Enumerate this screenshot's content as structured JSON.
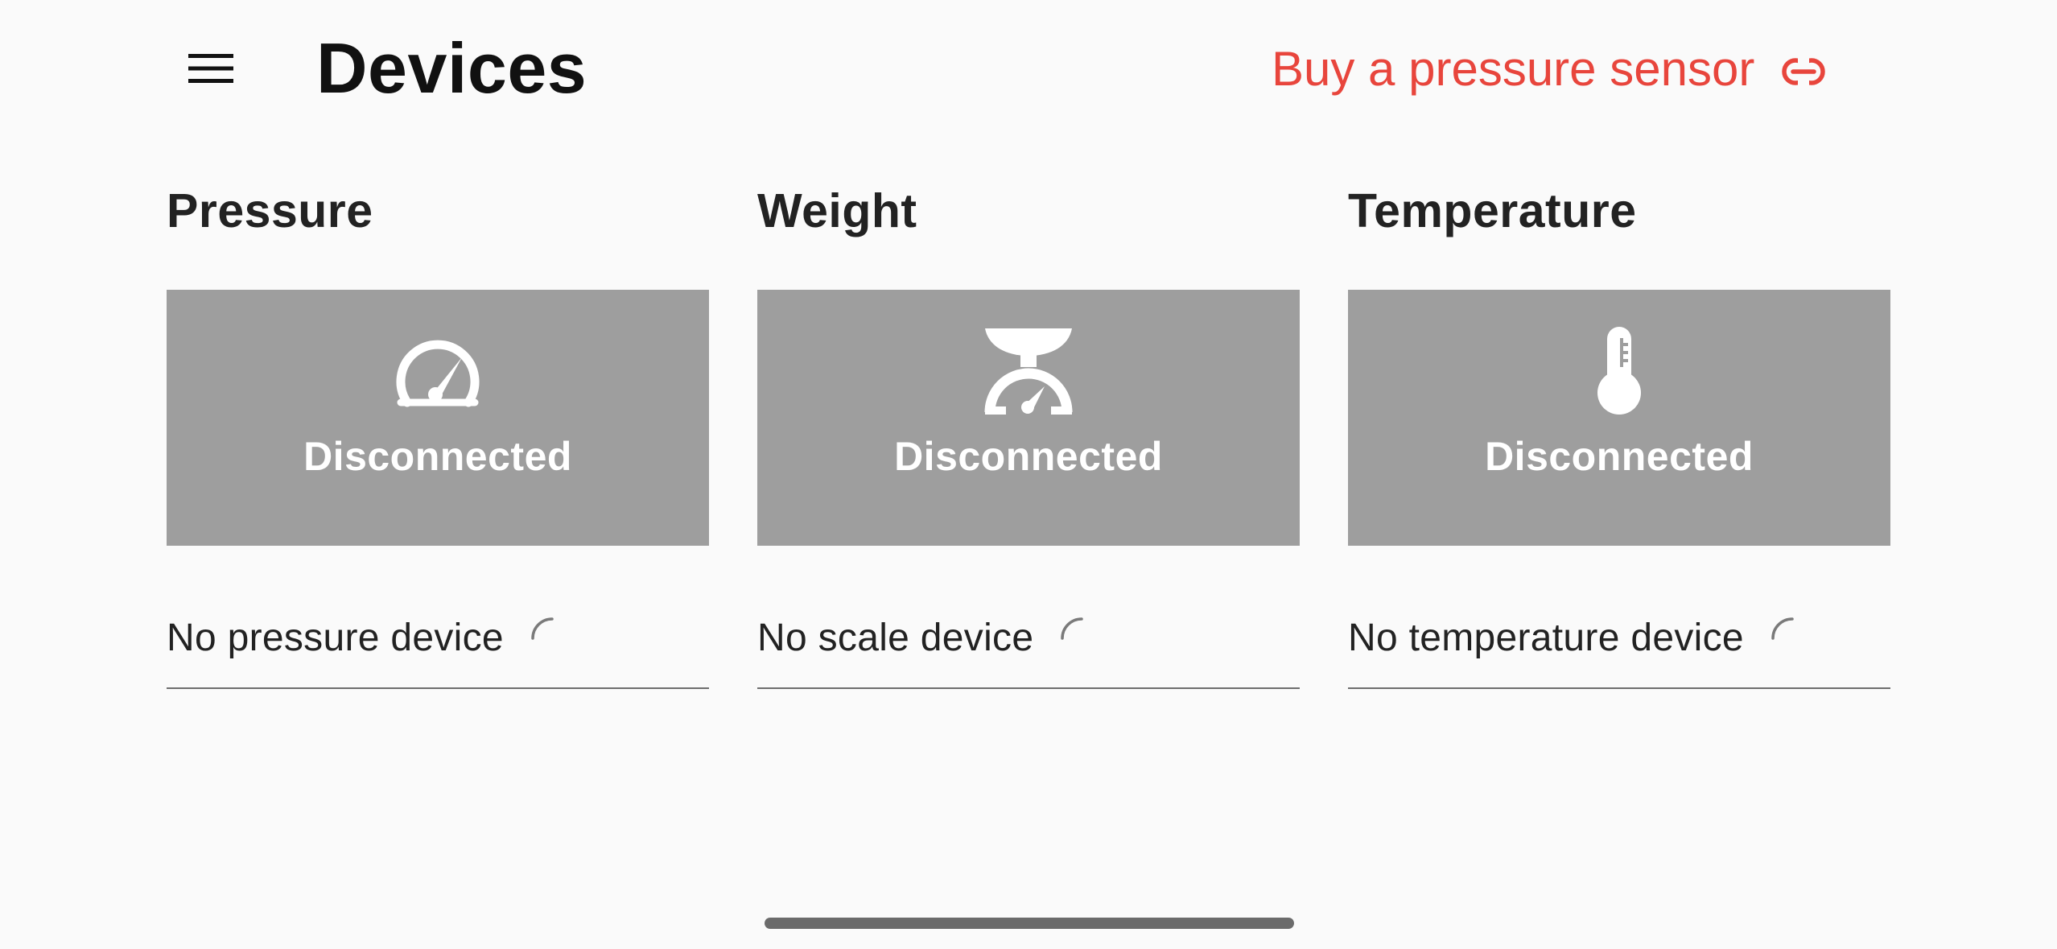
{
  "header": {
    "menu_icon": "hamburger-menu-icon",
    "title": "Devices",
    "buy_link_label": "Buy a pressure sensor",
    "buy_link_icon": "link-icon",
    "accent_color": "#e8453c"
  },
  "devices": [
    {
      "title": "Pressure",
      "icon": "gauge-icon",
      "status": "Disconnected",
      "select_label": "No pressure device",
      "loading_icon": "spinner-icon"
    },
    {
      "title": "Weight",
      "icon": "scale-icon",
      "status": "Disconnected",
      "select_label": "No scale device",
      "loading_icon": "spinner-icon"
    },
    {
      "title": "Temperature",
      "icon": "thermometer-icon",
      "status": "Disconnected",
      "select_label": "No temperature device",
      "loading_icon": "spinner-icon"
    }
  ],
  "colors": {
    "card_background": "#9e9e9e",
    "page_background": "#fafafa",
    "card_text": "#ffffff"
  }
}
